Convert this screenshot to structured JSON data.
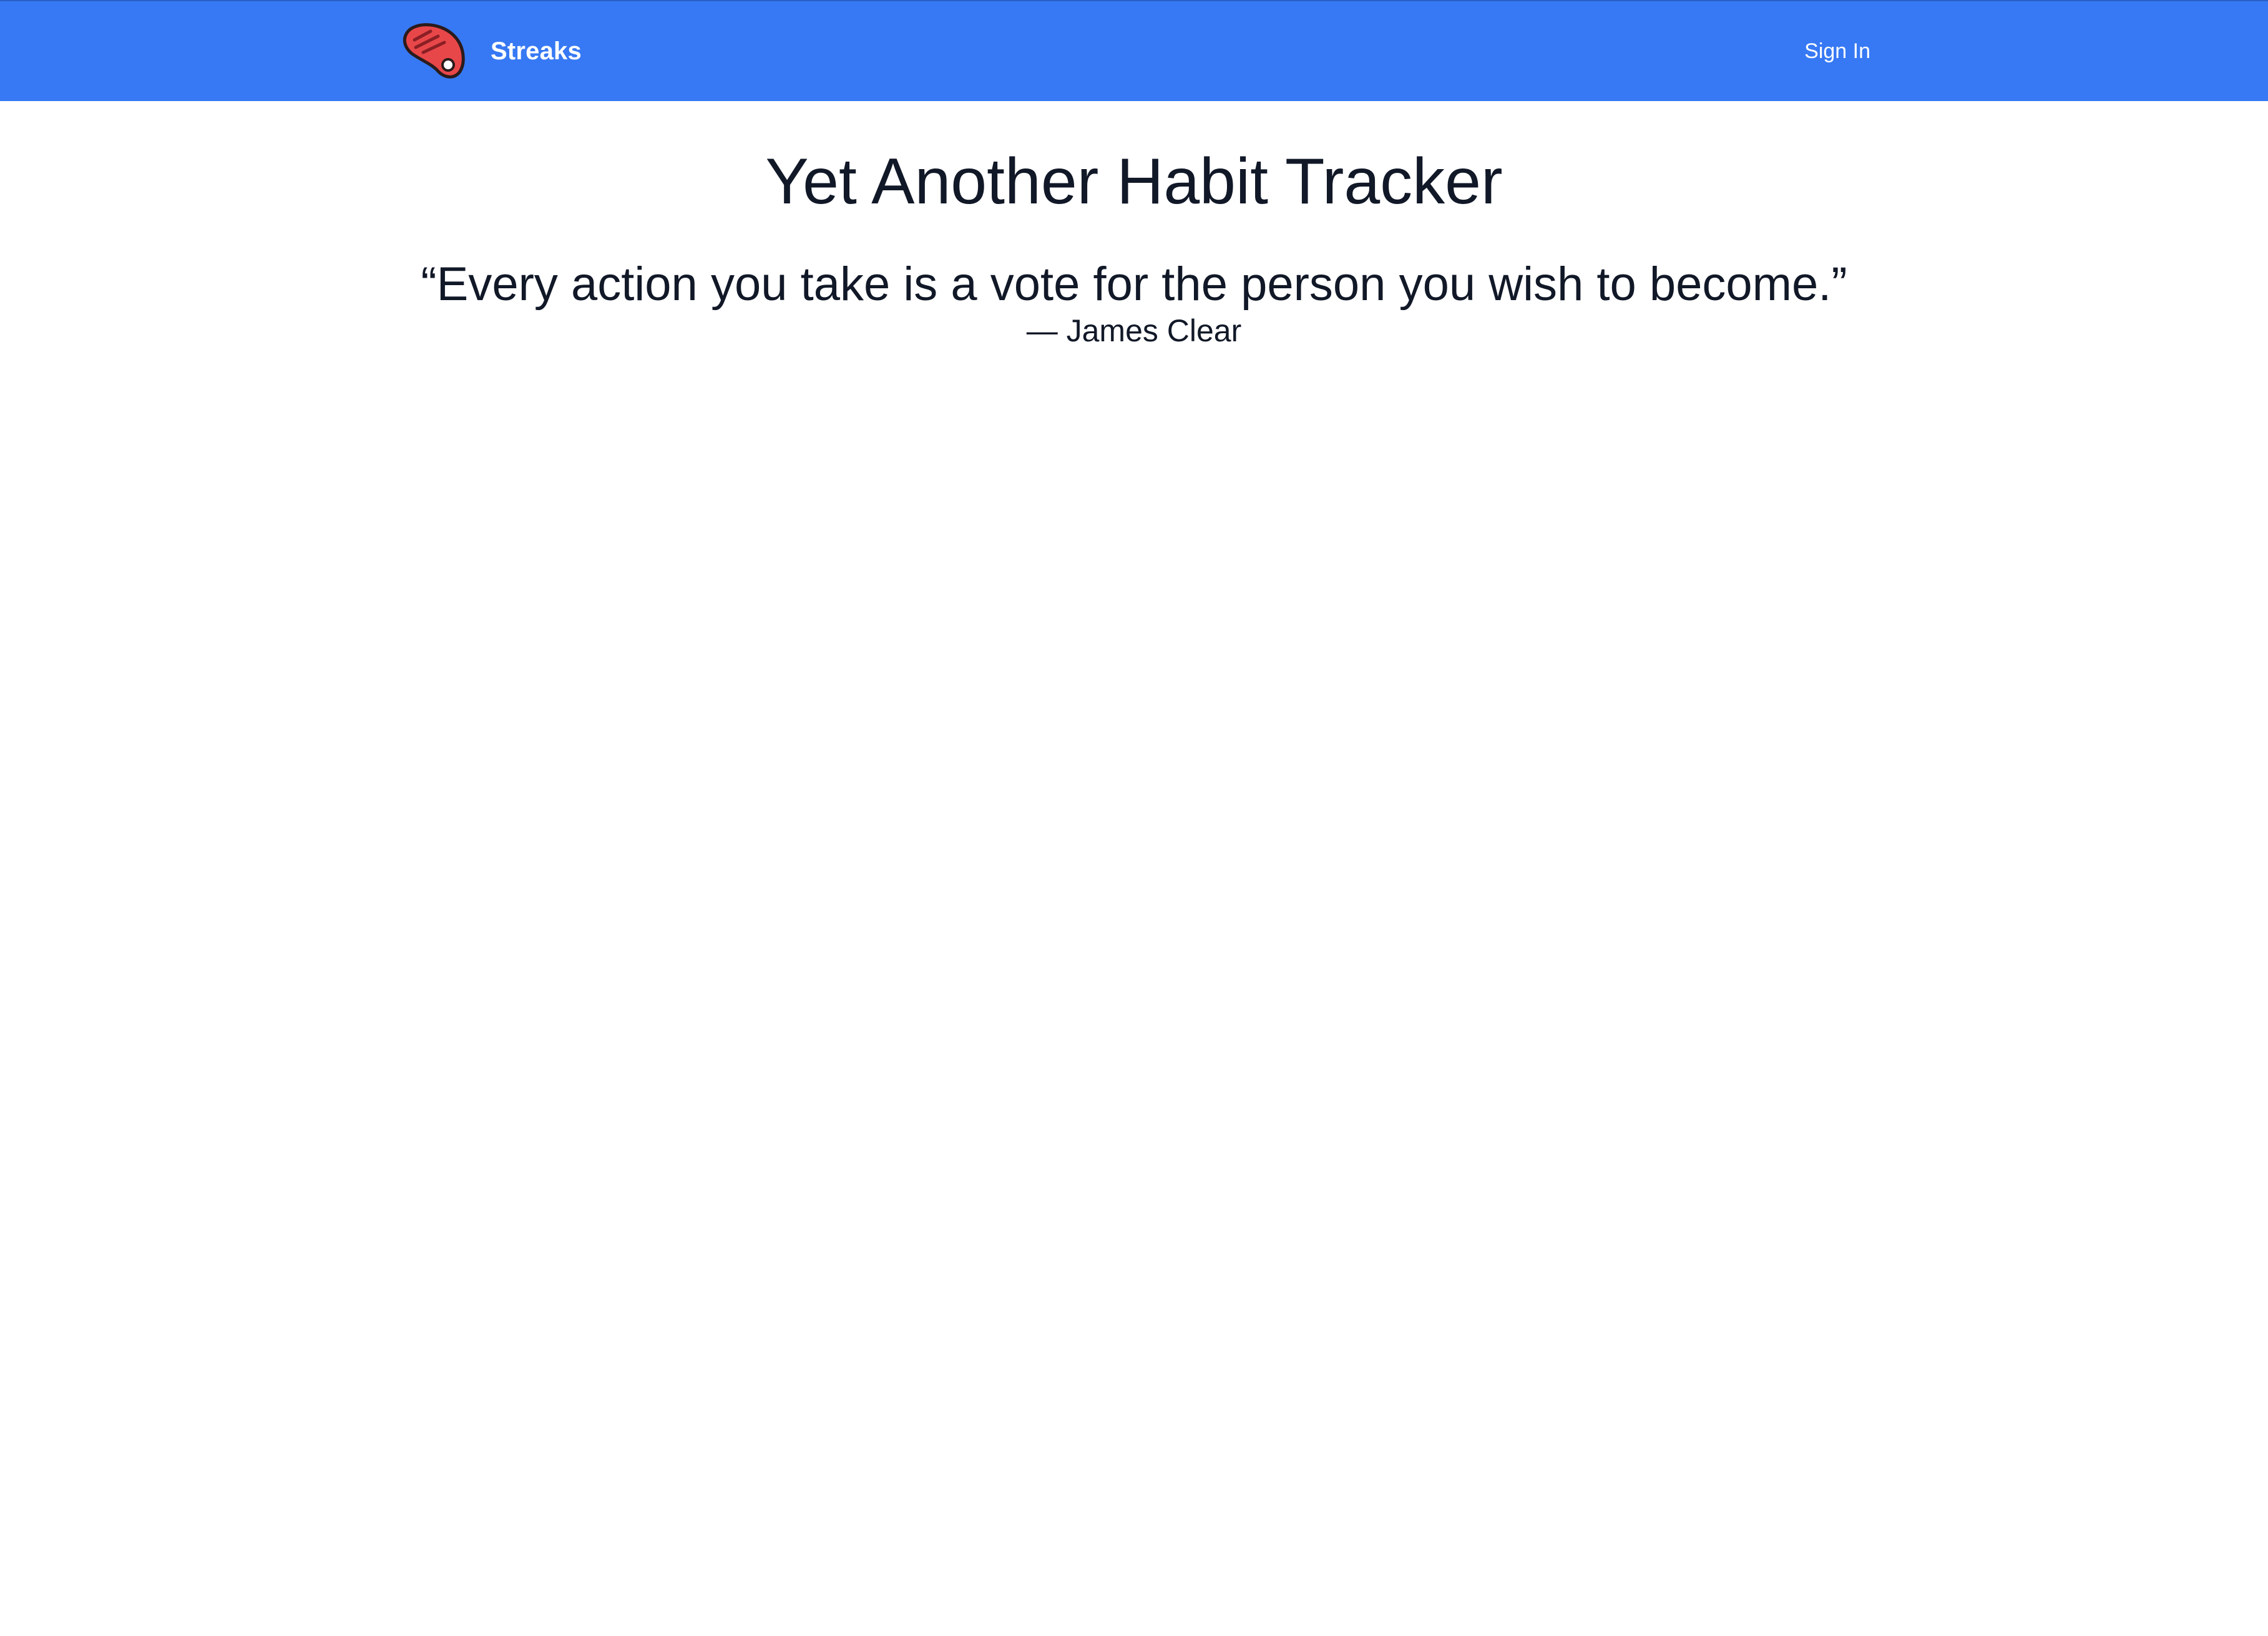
{
  "header": {
    "brand_name": "Streaks",
    "signin_label": "Sign In",
    "logo_icon": "steak-icon",
    "bg_color": "#3779f4"
  },
  "main": {
    "title": "Yet Another Habit Tracker",
    "quote": "“Every action you take is a vote for the person you wish to become.”",
    "attribution": "— James Clear"
  }
}
